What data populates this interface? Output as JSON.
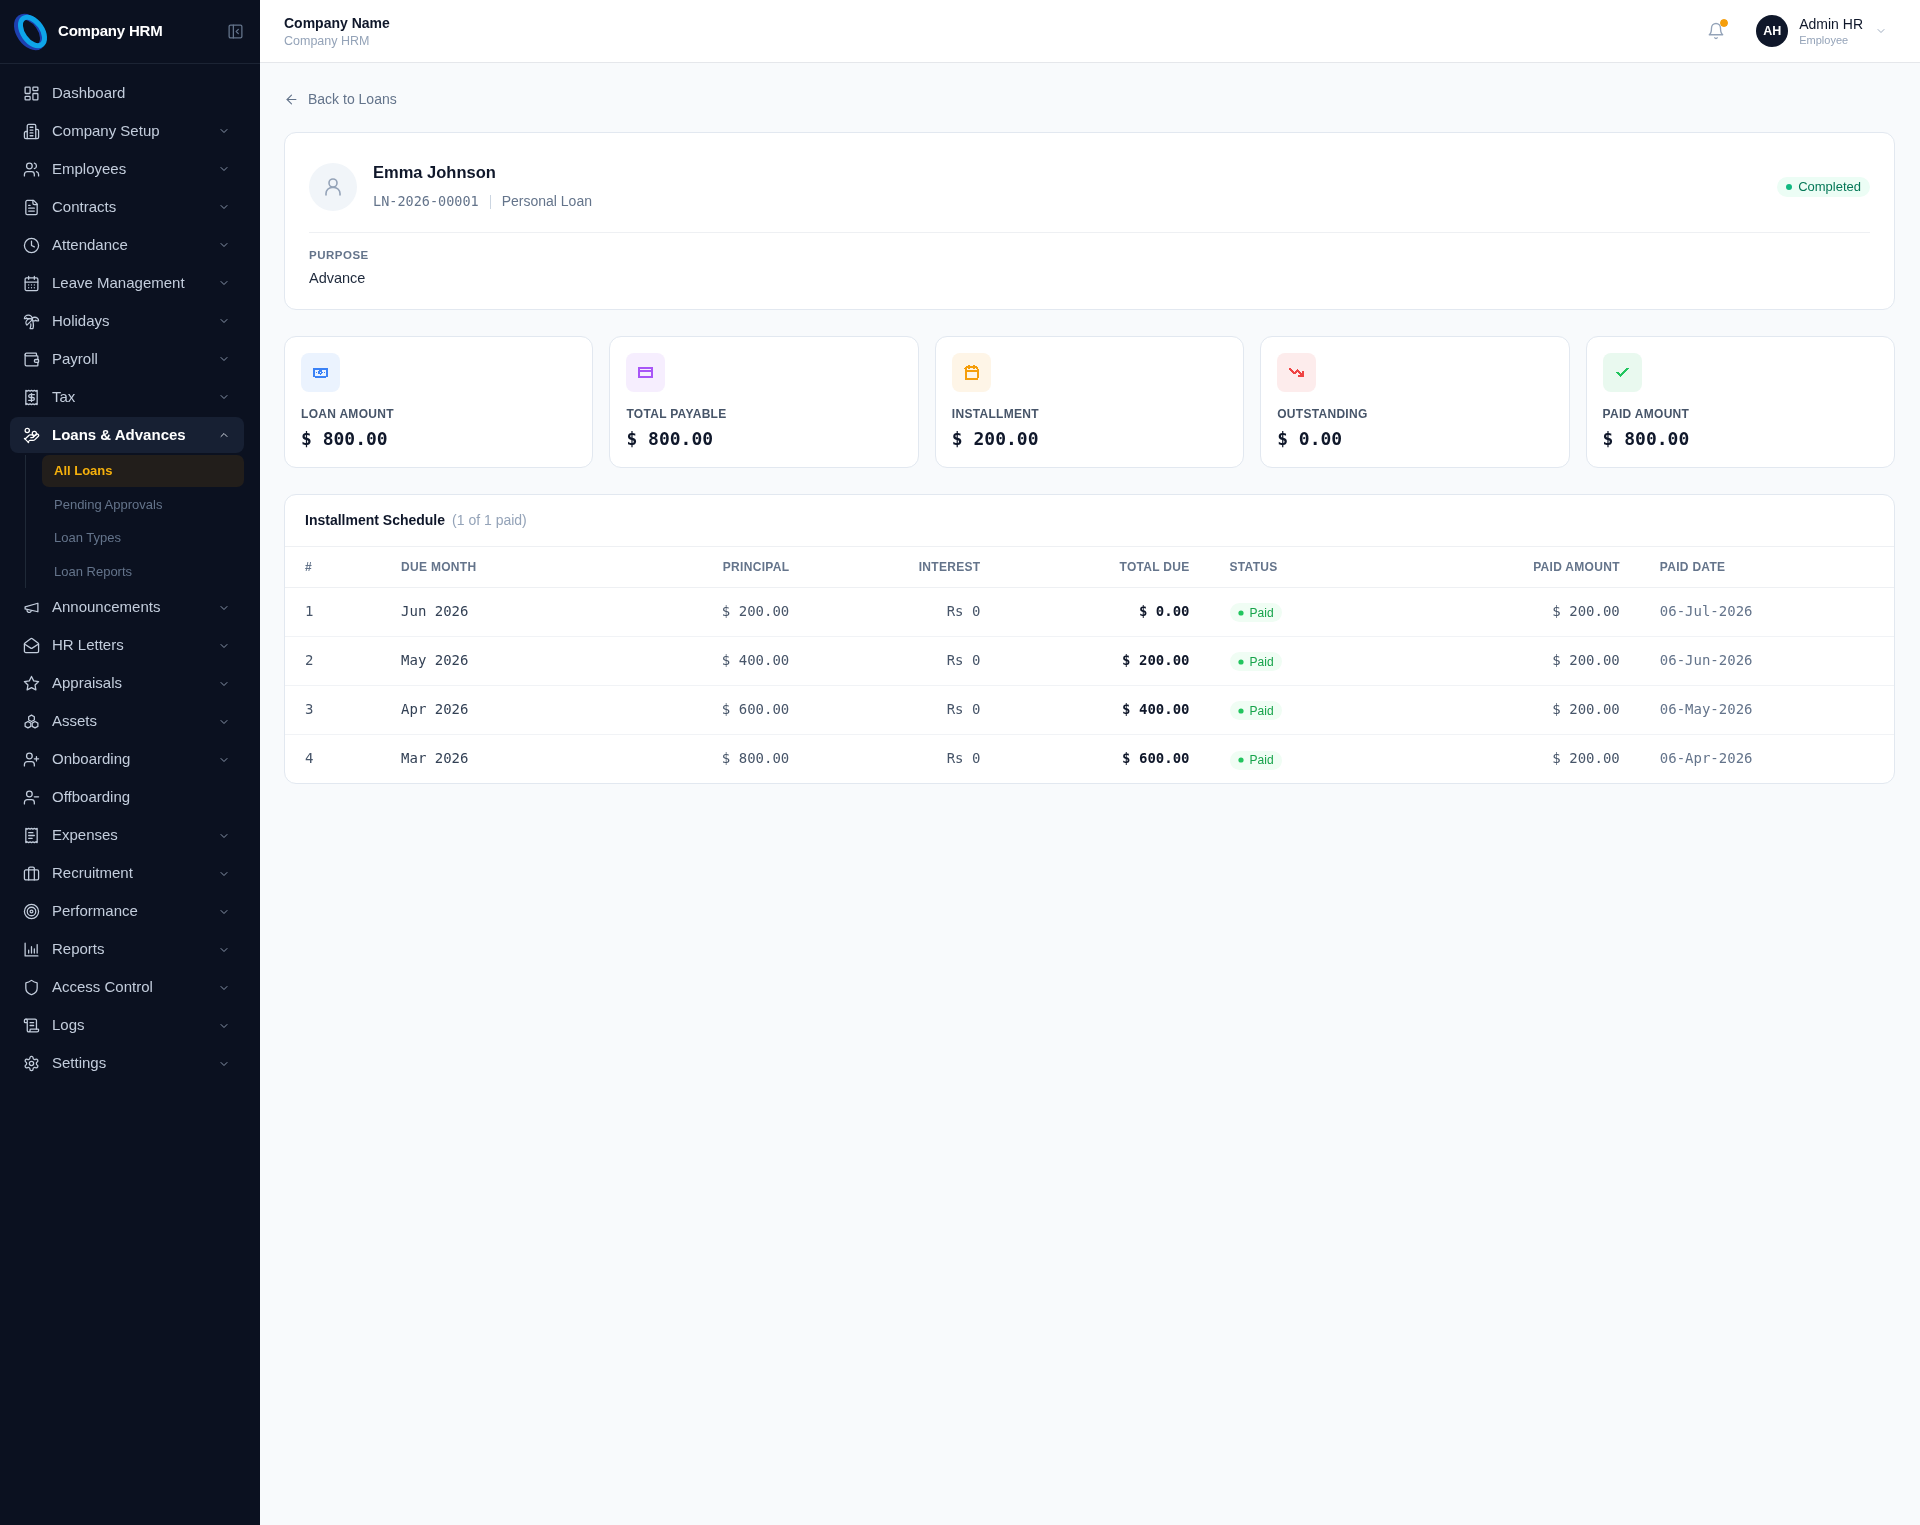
{
  "sidebar": {
    "brand": "Company HRM",
    "items": [
      {
        "label": "Dashboard",
        "kind": "link",
        "expanded": false,
        "selected": false
      },
      {
        "label": "Company Setup",
        "kind": "group",
        "expanded": false,
        "selected": false
      },
      {
        "label": "Employees",
        "kind": "group",
        "expanded": false,
        "selected": false
      },
      {
        "label": "Contracts",
        "kind": "group",
        "expanded": false,
        "selected": false
      },
      {
        "label": "Attendance",
        "kind": "group",
        "expanded": false,
        "selected": false
      },
      {
        "label": "Leave Management",
        "kind": "group",
        "expanded": false,
        "selected": false
      },
      {
        "label": "Holidays",
        "kind": "group",
        "expanded": false,
        "selected": false
      },
      {
        "label": "Payroll",
        "kind": "group",
        "expanded": false,
        "selected": false
      },
      {
        "label": "Tax",
        "kind": "group",
        "expanded": false,
        "selected": false
      },
      {
        "label": "Loans & Advances",
        "kind": "group",
        "expanded": true,
        "selected": true,
        "children": [
          {
            "label": "All Loans",
            "selected": true
          },
          {
            "label": "Pending Approvals",
            "selected": false
          },
          {
            "label": "Loan Types",
            "selected": false
          },
          {
            "label": "Loan Reports",
            "selected": false
          }
        ]
      },
      {
        "label": "Announcements",
        "kind": "group",
        "expanded": false,
        "selected": false
      },
      {
        "label": "HR Letters",
        "kind": "group",
        "expanded": false,
        "selected": false
      },
      {
        "label": "Appraisals",
        "kind": "group",
        "expanded": false,
        "selected": false
      },
      {
        "label": "Assets",
        "kind": "group",
        "expanded": false,
        "selected": false
      },
      {
        "label": "Onboarding",
        "kind": "group",
        "expanded": false,
        "selected": false
      },
      {
        "label": "Offboarding",
        "kind": "link",
        "expanded": false,
        "selected": false
      },
      {
        "label": "Expenses",
        "kind": "group",
        "expanded": false,
        "selected": false
      },
      {
        "label": "Recruitment",
        "kind": "group",
        "expanded": false,
        "selected": false
      },
      {
        "label": "Performance",
        "kind": "group",
        "expanded": false,
        "selected": false
      },
      {
        "label": "Reports",
        "kind": "group",
        "expanded": false,
        "selected": false
      },
      {
        "label": "Access Control",
        "kind": "group",
        "expanded": false,
        "selected": false
      },
      {
        "label": "Logs",
        "kind": "group",
        "expanded": false,
        "selected": false
      },
      {
        "label": "Settings",
        "kind": "group",
        "expanded": false,
        "selected": false
      }
    ]
  },
  "header": {
    "title": "Company Name",
    "subtitle": "Company HRM",
    "notifications_unread": true,
    "user": {
      "initials": "AH",
      "name": "Admin HR",
      "role": "Employee"
    }
  },
  "back_link": "Back to Loans",
  "loan": {
    "name": "Emma Johnson",
    "number": "LN-2026-00001",
    "type": "Personal Loan",
    "status": "Completed",
    "purpose_label": "PURPOSE",
    "purpose": "Advance"
  },
  "stats": [
    {
      "label": "LOAN AMOUNT",
      "value": "$ 800.00",
      "color": "#3b82f6"
    },
    {
      "label": "TOTAL PAYABLE",
      "value": "$ 800.00",
      "color": "#a855f7"
    },
    {
      "label": "INSTALLMENT",
      "value": "$ 200.00",
      "color": "#f59e0b"
    },
    {
      "label": "OUTSTANDING",
      "value": "$ 0.00",
      "color": "#ef4444"
    },
    {
      "label": "PAID AMOUNT",
      "value": "$ 800.00",
      "color": "#22c55e"
    }
  ],
  "schedule": {
    "title": "Installment Schedule",
    "summary": "(1 of 1 paid)",
    "columns": [
      "#",
      "DUE MONTH",
      "PRINCIPAL",
      "INTEREST",
      "TOTAL DUE",
      "STATUS",
      "PAID AMOUNT",
      "PAID DATE"
    ],
    "rows": [
      {
        "number": "1",
        "due_month": "Jun 2026",
        "principal": "$ 200.00",
        "interest": "Rs 0",
        "total_due": "$ 0.00",
        "status": "Paid",
        "paid_amount": "$ 200.00",
        "paid_date": "06-Jul-2026"
      },
      {
        "number": "2",
        "due_month": "May 2026",
        "principal": "$ 400.00",
        "interest": "Rs 0",
        "total_due": "$ 200.00",
        "status": "Paid",
        "paid_amount": "$ 200.00",
        "paid_date": "06-Jun-2026"
      },
      {
        "number": "3",
        "due_month": "Apr 2026",
        "principal": "$ 600.00",
        "interest": "Rs 0",
        "total_due": "$ 400.00",
        "status": "Paid",
        "paid_amount": "$ 200.00",
        "paid_date": "06-May-2026"
      },
      {
        "number": "4",
        "due_month": "Mar 2026",
        "principal": "$ 800.00",
        "interest": "Rs 0",
        "total_due": "$ 600.00",
        "status": "Paid",
        "paid_amount": "$ 200.00",
        "paid_date": "06-Apr-2026"
      }
    ]
  }
}
